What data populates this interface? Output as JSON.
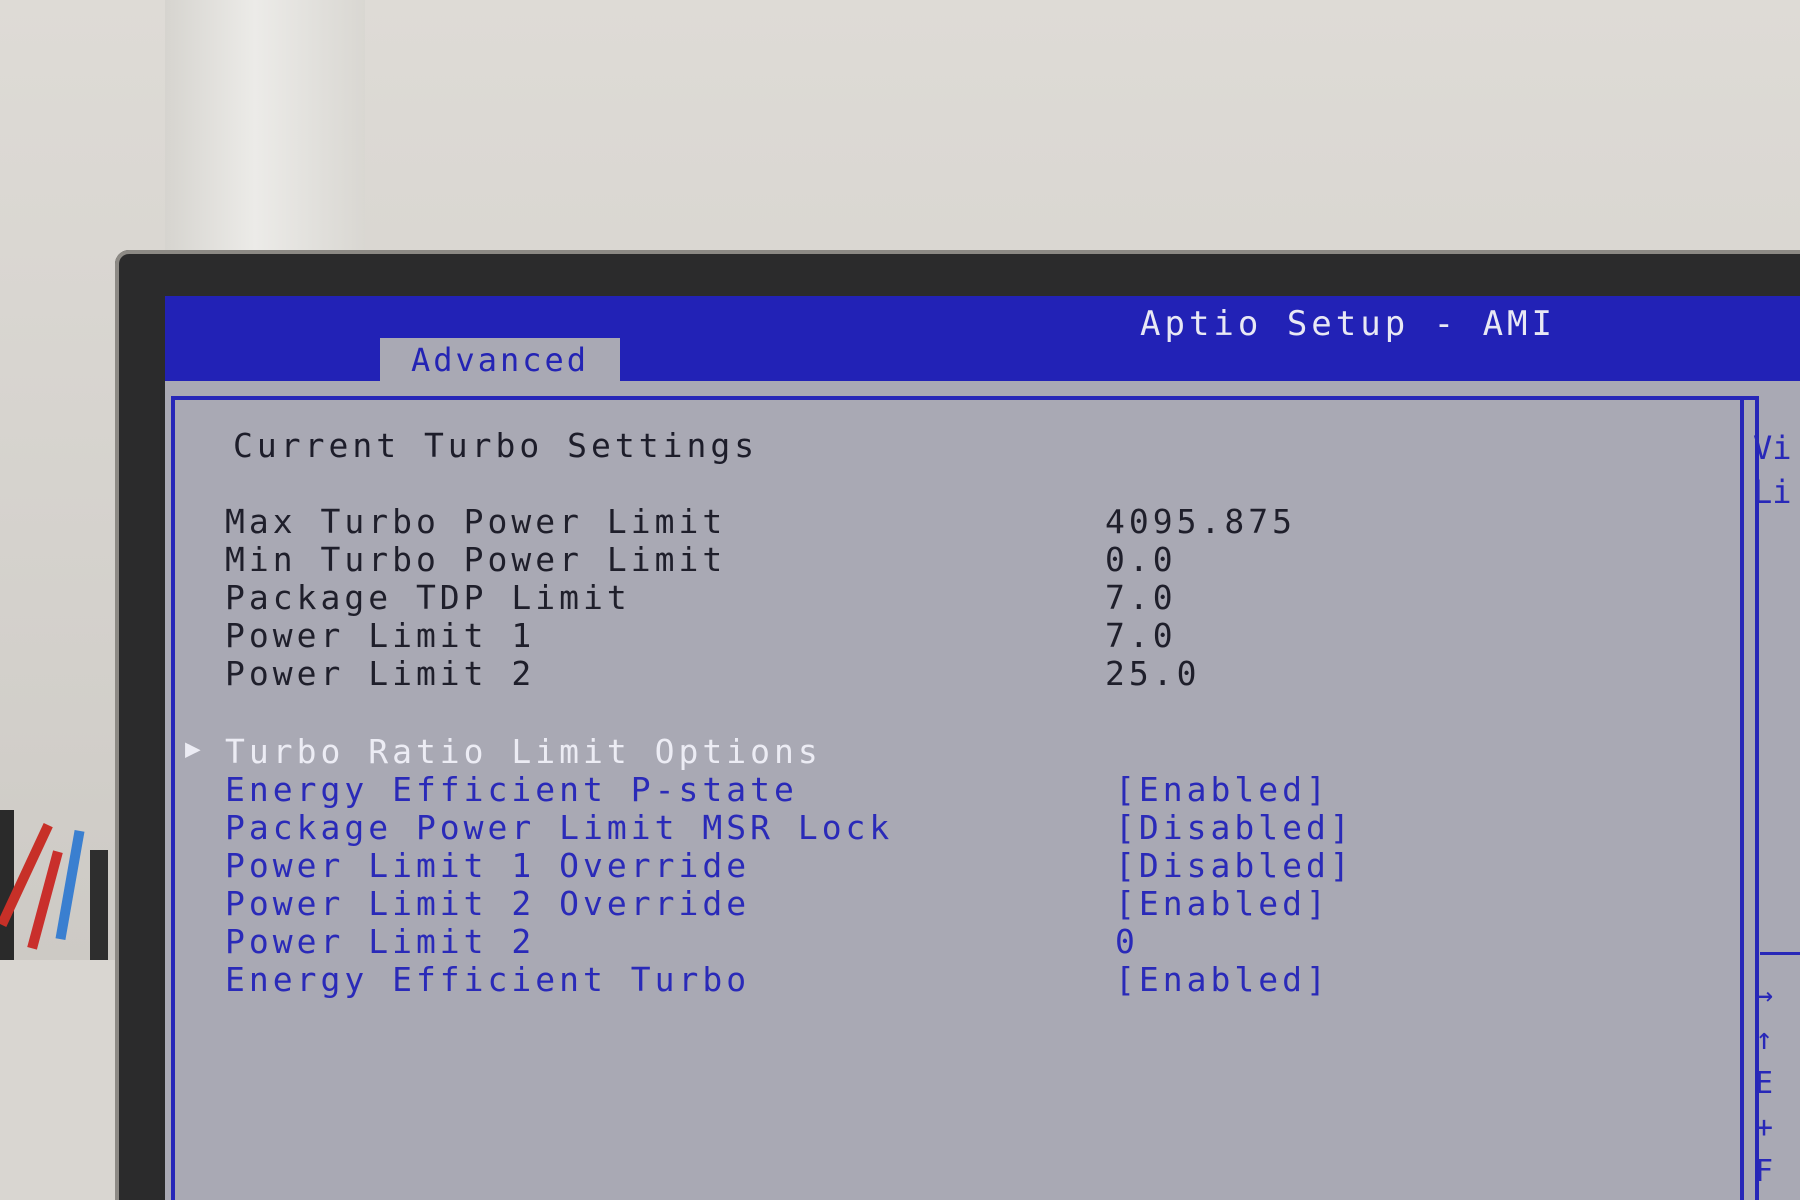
{
  "header": {
    "app_title": "Aptio Setup - AMI",
    "active_tab": "Advanced"
  },
  "main": {
    "section_title": "Current Turbo Settings",
    "info_rows": [
      {
        "label": "Max Turbo Power Limit",
        "value": "4095.875"
      },
      {
        "label": "Min Turbo Power Limit",
        "value": "0.0"
      },
      {
        "label": "Package TDP Limit",
        "value": "7.0"
      },
      {
        "label": "Power Limit 1",
        "value": "7.0"
      },
      {
        "label": "Power Limit 2",
        "value": "25.0"
      }
    ],
    "submenu": {
      "label": "Turbo Ratio Limit Options",
      "arrow": "▶"
    },
    "options": [
      {
        "label": "Energy Efficient P-state",
        "value": "[Enabled]"
      },
      {
        "label": "Package Power Limit MSR Lock",
        "value": "[Disabled]"
      },
      {
        "label": "Power Limit 1 Override",
        "value": "[Disabled]"
      },
      {
        "label": "Power Limit 2 Override",
        "value": "[Enabled]"
      },
      {
        "label": "Power Limit 2",
        "value": "0"
      },
      {
        "label": "Energy Efficient Turbo",
        "value": "[Enabled]"
      }
    ]
  },
  "help_panel": {
    "line1": "Vi",
    "line2": "Li",
    "keys": [
      "→",
      "↑",
      "E",
      "+",
      "F"
    ]
  },
  "colors": {
    "bar_blue": "#2222b6",
    "screen_gray": "#a9a9b4",
    "option_blue": "#2a2ab8",
    "highlight_white": "#ececf4"
  }
}
